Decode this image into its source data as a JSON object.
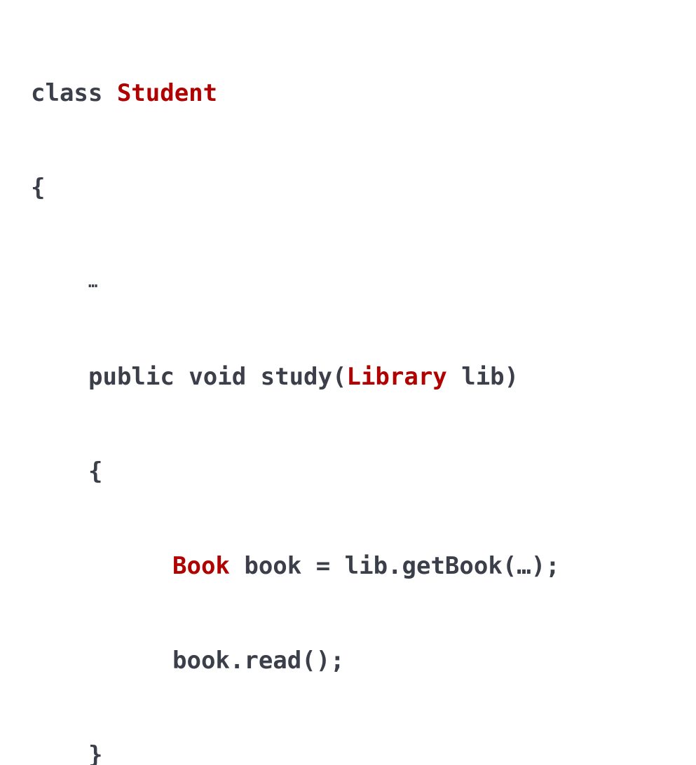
{
  "code": {
    "line1": {
      "keyword": "class ",
      "type": "Student"
    },
    "line2": {
      "text": "{"
    },
    "line3": {
      "text": "…"
    },
    "line4": {
      "prefix": "public void study(",
      "type": "Library",
      "suffix": " lib)"
    },
    "line5": {
      "text": "{"
    },
    "line6": {
      "type": "Book",
      "suffix": " book = lib.getBook(…);"
    },
    "line7": {
      "text": "book.read();"
    },
    "line8": {
      "text": "}"
    }
  },
  "colors": {
    "text": "#3b3f4a",
    "type_highlight": "#b00000",
    "background": "#ffffff"
  }
}
